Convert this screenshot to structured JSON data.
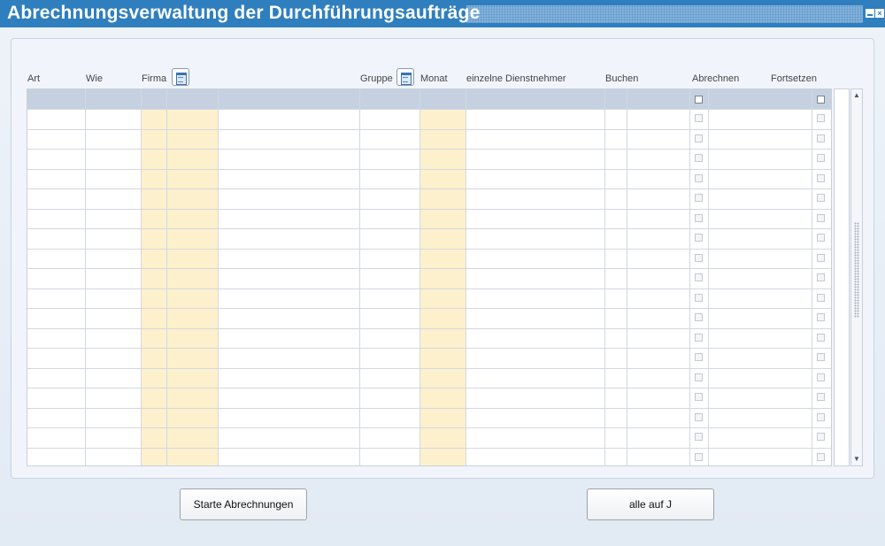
{
  "window": {
    "title": "Abrechnungsverwaltung der Durchführungsaufträge"
  },
  "columns": {
    "art": "Art",
    "wie": "Wie",
    "firma": "Firma",
    "gruppe": "Gruppe",
    "monat": "Monat",
    "dienstnehmer": "einzelne Dienstnehmer",
    "buchen": "Buchen",
    "abrechnen": "Abrechnen",
    "fortsetzen": "Fortsetzen"
  },
  "icons": {
    "firma_lookup": "calendar-icon",
    "gruppe_lookup": "calendar-icon",
    "scroll_up": "arrow-up-icon",
    "scroll_down": "arrow-down-icon"
  },
  "grid": {
    "filter_row": {
      "abrechnen_checked": false,
      "fortsetzen_checked": false
    },
    "rows": [
      {},
      {},
      {},
      {},
      {},
      {},
      {},
      {},
      {},
      {},
      {},
      {},
      {},
      {},
      {},
      {},
      {},
      {}
    ]
  },
  "buttons": {
    "start": "Starte Abrechnungen",
    "all_j": "alle auf J"
  },
  "colors": {
    "titlebar": "#2f7fbf",
    "highlight_column": "#fdf0cd",
    "filter_row": "#c5d1e0"
  }
}
